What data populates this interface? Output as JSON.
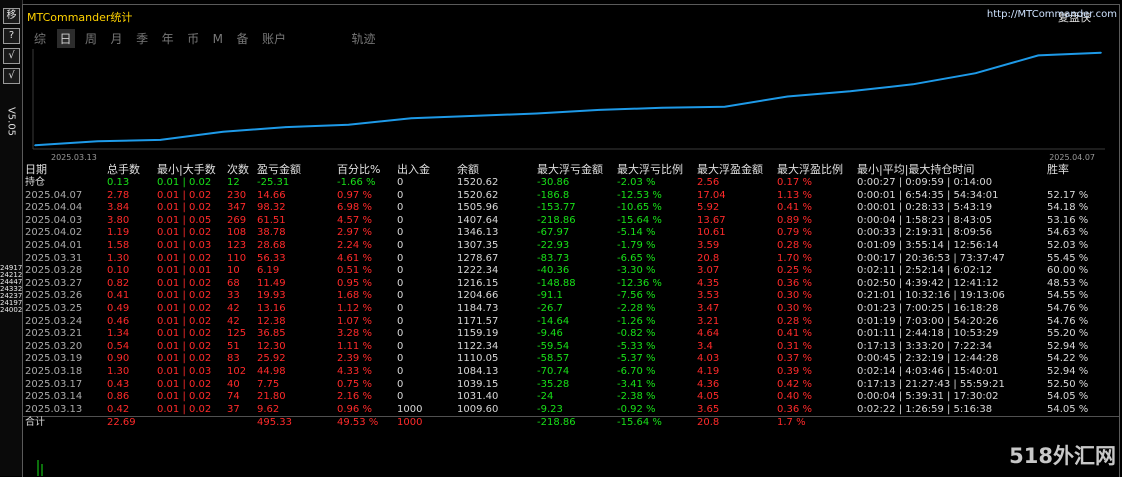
{
  "left_strip": {
    "buttons": [
      "移",
      "?",
      "√"
    ],
    "version": "V5.05",
    "ghost_prices": [
      "24917",
      "24212",
      "24447",
      "24332",
      "24237",
      "24197",
      "24002"
    ]
  },
  "header": {
    "title": "MTCommander统计",
    "brand": "复盘侠",
    "link": "http://MTCommander.com"
  },
  "tabs": [
    "综",
    "日",
    "周",
    "月",
    "季",
    "年",
    "币",
    "M",
    "备",
    "账户",
    "轨迹"
  ],
  "active_tab": 1,
  "chart_data": {
    "type": "line",
    "title": "",
    "x_start_label": "2025.03.13",
    "x_end_label": "2025.04.07",
    "x": [
      "2025.03.13",
      "2025.03.14",
      "2025.03.17",
      "2025.03.18",
      "2025.03.19",
      "2025.03.20",
      "2025.03.21",
      "2025.03.24",
      "2025.03.25",
      "2025.03.26",
      "2025.03.27",
      "2025.03.28",
      "2025.03.31",
      "2025.04.01",
      "2025.04.02",
      "2025.04.03",
      "2025.04.04",
      "2025.04.07"
    ],
    "values": [
      1009.6,
      1031.4,
      1039.15,
      1084.13,
      1110.05,
      1122.34,
      1159.19,
      1171.57,
      1184.73,
      1204.66,
      1216.15,
      1222.34,
      1278.67,
      1307.35,
      1346.13,
      1407.64,
      1505.96,
      1520.62
    ],
    "ylim": [
      1000,
      1530
    ],
    "color": "#1e9ae8"
  },
  "table": {
    "headers": [
      "日期",
      "总手数",
      "最小|大手数",
      "次数",
      "盈亏金额",
      "百分比%",
      "出入金",
      "余额",
      "最大浮亏金额",
      "最大浮亏比例",
      "最大浮盈金额",
      "最大浮盈比例",
      "最小|平均|最大持仓时间",
      "胜率"
    ],
    "holding": {
      "label": "持仓",
      "lots": "0.13",
      "minmax": "0.01 | 0.02",
      "count": "12",
      "pnl": "-25.31",
      "pct": "-1.66 %",
      "flow": "0",
      "balance": "1520.62",
      "dd": "-30.86",
      "dd_pct": "-2.03 %",
      "fp": "2.56",
      "fp_pct": "0.17 %",
      "times": "0:00:27 | 0:09:59 | 0:14:00",
      "win": ""
    },
    "rows": [
      {
        "date": "2025.04.07",
        "lots": "2.78",
        "minmax": "0.01 | 0.02",
        "count": "230",
        "pnl": "14.66",
        "pct": "0.97 %",
        "flow": "0",
        "balance": "1520.62",
        "dd": "-186.8",
        "dd_pct": "-12.53 %",
        "fp": "17.04",
        "fp_pct": "1.13 %",
        "times": "0:00:01 | 6:54:35 | 54:34:01",
        "win": "52.17 %"
      },
      {
        "date": "2025.04.04",
        "lots": "3.84",
        "minmax": "0.01 | 0.02",
        "count": "347",
        "pnl": "98.32",
        "pct": "6.98 %",
        "flow": "0",
        "balance": "1505.96",
        "dd": "-153.77",
        "dd_pct": "-10.65 %",
        "fp": "5.92",
        "fp_pct": "0.41 %",
        "times": "0:00:01 | 0:28:33 | 5:43:19",
        "win": "54.18 %"
      },
      {
        "date": "2025.04.03",
        "lots": "3.80",
        "minmax": "0.01 | 0.05",
        "count": "269",
        "pnl": "61.51",
        "pct": "4.57 %",
        "flow": "0",
        "balance": "1407.64",
        "dd": "-218.86",
        "dd_pct": "-15.64 %",
        "fp": "13.67",
        "fp_pct": "0.89 %",
        "times": "0:00:04 | 1:58:23 | 8:43:05",
        "win": "53.16 %"
      },
      {
        "date": "2025.04.02",
        "lots": "1.19",
        "minmax": "0.01 | 0.02",
        "count": "108",
        "pnl": "38.78",
        "pct": "2.97 %",
        "flow": "0",
        "balance": "1346.13",
        "dd": "-67.97",
        "dd_pct": "-5.14 %",
        "fp": "10.61",
        "fp_pct": "0.79 %",
        "times": "0:00:33 | 2:19:31 | 8:09:56",
        "win": "54.63 %"
      },
      {
        "date": "2025.04.01",
        "lots": "1.58",
        "minmax": "0.01 | 0.03",
        "count": "123",
        "pnl": "28.68",
        "pct": "2.24 %",
        "flow": "0",
        "balance": "1307.35",
        "dd": "-22.93",
        "dd_pct": "-1.79 %",
        "fp": "3.59",
        "fp_pct": "0.28 %",
        "times": "0:01:09 | 3:55:14 | 12:56:14",
        "win": "52.03 %"
      },
      {
        "date": "2025.03.31",
        "lots": "1.30",
        "minmax": "0.01 | 0.02",
        "count": "110",
        "pnl": "56.33",
        "pct": "4.61 %",
        "flow": "0",
        "balance": "1278.67",
        "dd": "-83.73",
        "dd_pct": "-6.65 %",
        "fp": "20.8",
        "fp_pct": "1.70 %",
        "times": "0:00:17 | 20:36:53 | 73:37:47",
        "win": "55.45 %"
      },
      {
        "date": "2025.03.28",
        "lots": "0.10",
        "minmax": "0.01 | 0.01",
        "count": "10",
        "pnl": "6.19",
        "pct": "0.51 %",
        "flow": "0",
        "balance": "1222.34",
        "dd": "-40.36",
        "dd_pct": "-3.30 %",
        "fp": "3.07",
        "fp_pct": "0.25 %",
        "times": "0:02:11 | 2:52:14 | 6:02:12",
        "win": "60.00 %"
      },
      {
        "date": "2025.03.27",
        "lots": "0.82",
        "minmax": "0.01 | 0.02",
        "count": "68",
        "pnl": "11.49",
        "pct": "0.95 %",
        "flow": "0",
        "balance": "1216.15",
        "dd": "-148.88",
        "dd_pct": "-12.36 %",
        "fp": "4.35",
        "fp_pct": "0.36 %",
        "times": "0:02:50 | 4:39:42 | 12:41:12",
        "win": "48.53 %"
      },
      {
        "date": "2025.03.26",
        "lots": "0.41",
        "minmax": "0.01 | 0.02",
        "count": "33",
        "pnl": "19.93",
        "pct": "1.68 %",
        "flow": "0",
        "balance": "1204.66",
        "dd": "-91.1",
        "dd_pct": "-7.56 %",
        "fp": "3.53",
        "fp_pct": "0.30 %",
        "times": "0:21:01 | 10:32:16 | 19:13:06",
        "win": "54.55 %"
      },
      {
        "date": "2025.03.25",
        "lots": "0.49",
        "minmax": "0.01 | 0.02",
        "count": "42",
        "pnl": "13.16",
        "pct": "1.12 %",
        "flow": "0",
        "balance": "1184.73",
        "dd": "-26.7",
        "dd_pct": "-2.28 %",
        "fp": "3.47",
        "fp_pct": "0.30 %",
        "times": "0:01:23 | 7:00:25 | 16:18:28",
        "win": "54.76 %"
      },
      {
        "date": "2025.03.24",
        "lots": "0.46",
        "minmax": "0.01 | 0.02",
        "count": "42",
        "pnl": "12.38",
        "pct": "1.07 %",
        "flow": "0",
        "balance": "1171.57",
        "dd": "-14.64",
        "dd_pct": "-1.26 %",
        "fp": "3.21",
        "fp_pct": "0.28 %",
        "times": "0:01:19 | 7:03:00 | 54:20:26",
        "win": "54.76 %"
      },
      {
        "date": "2025.03.21",
        "lots": "1.34",
        "minmax": "0.01 | 0.02",
        "count": "125",
        "pnl": "36.85",
        "pct": "3.28 %",
        "flow": "0",
        "balance": "1159.19",
        "dd": "-9.46",
        "dd_pct": "-0.82 %",
        "fp": "4.64",
        "fp_pct": "0.41 %",
        "times": "0:01:11 | 2:44:18 | 10:53:29",
        "win": "55.20 %"
      },
      {
        "date": "2025.03.20",
        "lots": "0.54",
        "minmax": "0.01 | 0.02",
        "count": "51",
        "pnl": "12.30",
        "pct": "1.11 %",
        "flow": "0",
        "balance": "1122.34",
        "dd": "-59.54",
        "dd_pct": "-5.33 %",
        "fp": "3.4",
        "fp_pct": "0.31 %",
        "times": "0:17:13 | 3:33:20 | 7:22:34",
        "win": "52.94 %"
      },
      {
        "date": "2025.03.19",
        "lots": "0.90",
        "minmax": "0.01 | 0.02",
        "count": "83",
        "pnl": "25.92",
        "pct": "2.39 %",
        "flow": "0",
        "balance": "1110.05",
        "dd": "-58.57",
        "dd_pct": "-5.37 %",
        "fp": "4.03",
        "fp_pct": "0.37 %",
        "times": "0:00:45 | 2:32:19 | 12:44:28",
        "win": "54.22 %"
      },
      {
        "date": "2025.03.18",
        "lots": "1.30",
        "minmax": "0.01 | 0.03",
        "count": "102",
        "pnl": "44.98",
        "pct": "4.33 %",
        "flow": "0",
        "balance": "1084.13",
        "dd": "-70.74",
        "dd_pct": "-6.70 %",
        "fp": "4.19",
        "fp_pct": "0.39 %",
        "times": "0:02:14 | 4:03:46 | 15:40:01",
        "win": "52.94 %"
      },
      {
        "date": "2025.03.17",
        "lots": "0.43",
        "minmax": "0.01 | 0.02",
        "count": "40",
        "pnl": "7.75",
        "pct": "0.75 %",
        "flow": "0",
        "balance": "1039.15",
        "dd": "-35.28",
        "dd_pct": "-3.41 %",
        "fp": "4.36",
        "fp_pct": "0.42 %",
        "times": "0:17:13 | 21:27:43 | 55:59:21",
        "win": "52.50 %"
      },
      {
        "date": "2025.03.14",
        "lots": "0.86",
        "minmax": "0.01 | 0.02",
        "count": "74",
        "pnl": "21.80",
        "pct": "2.16 %",
        "flow": "0",
        "balance": "1031.40",
        "dd": "-24",
        "dd_pct": "-2.38 %",
        "fp": "4.05",
        "fp_pct": "0.40 %",
        "times": "0:00:04 | 5:39:31 | 17:30:02",
        "win": "54.05 %"
      },
      {
        "date": "2025.03.13",
        "lots": "0.42",
        "minmax": "0.01 | 0.02",
        "count": "37",
        "pnl": "9.62",
        "pct": "0.96 %",
        "flow": "1000",
        "balance": "1009.60",
        "dd": "-9.23",
        "dd_pct": "-0.92 %",
        "fp": "3.65",
        "fp_pct": "0.36 %",
        "times": "0:02:22 | 1:26:59 | 5:16:38",
        "win": "54.05 %"
      }
    ],
    "total": {
      "label": "合计",
      "lots": "22.69",
      "pnl": "495.33",
      "pct": "49.53 %",
      "flow": "1000",
      "dd": "-218.86",
      "dd_pct": "-15.64 %",
      "fp": "20.8",
      "fp_pct": "1.7 %"
    }
  },
  "watermark": "518外汇网",
  "colors": {
    "positive": "#ff2a2a",
    "negative": "#18e018",
    "title": "#ffd200",
    "line": "#1e9ae8"
  }
}
